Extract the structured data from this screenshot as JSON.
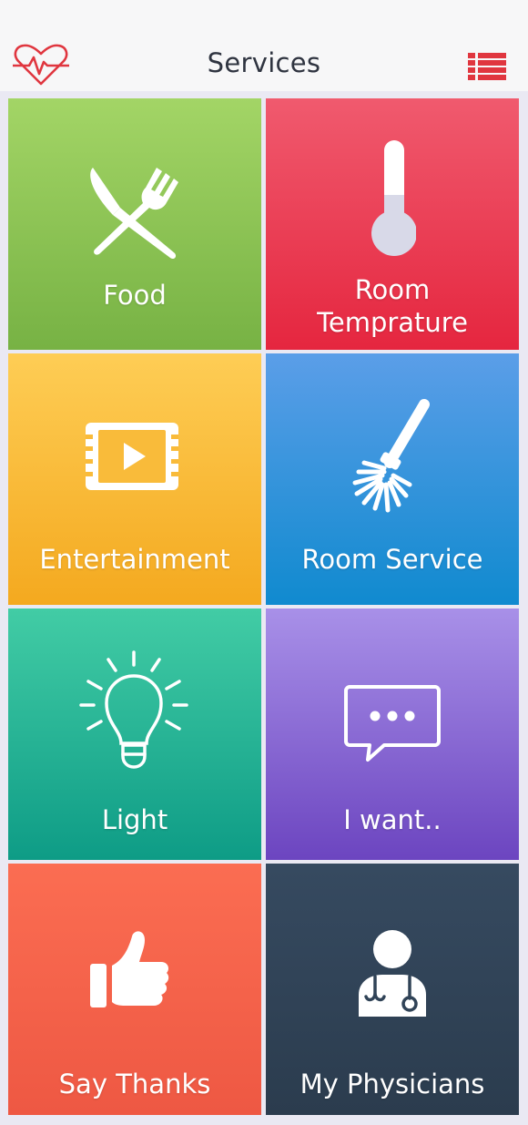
{
  "header": {
    "title": "Services",
    "logo_icon": "heartbeat-icon",
    "menu_icon": "list-menu-icon",
    "accent_color": "#e0363f"
  },
  "tiles": [
    {
      "label": "Food",
      "icon": "fork-knife-icon",
      "color": "#8cc653"
    },
    {
      "label_line1": "Room",
      "label_line2": "Temprature",
      "icon": "thermometer-icon",
      "color": "#ea3a52"
    },
    {
      "label": "Entertainment",
      "icon": "film-play-icon",
      "color": "#f9bb3a"
    },
    {
      "label": "Room Service",
      "icon": "cleaning-brush-icon",
      "color": "#3594dc"
    },
    {
      "label": "Light",
      "icon": "light-bulb-icon",
      "color": "#28b496"
    },
    {
      "label": "I want..",
      "icon": "chat-bubble-icon",
      "color": "#8a6ad4"
    },
    {
      "label": "Say Thanks",
      "icon": "thumbs-up-icon",
      "color": "#f4624b"
    },
    {
      "label": "My Physicians",
      "icon": "doctor-icon",
      "color": "#304357"
    }
  ]
}
